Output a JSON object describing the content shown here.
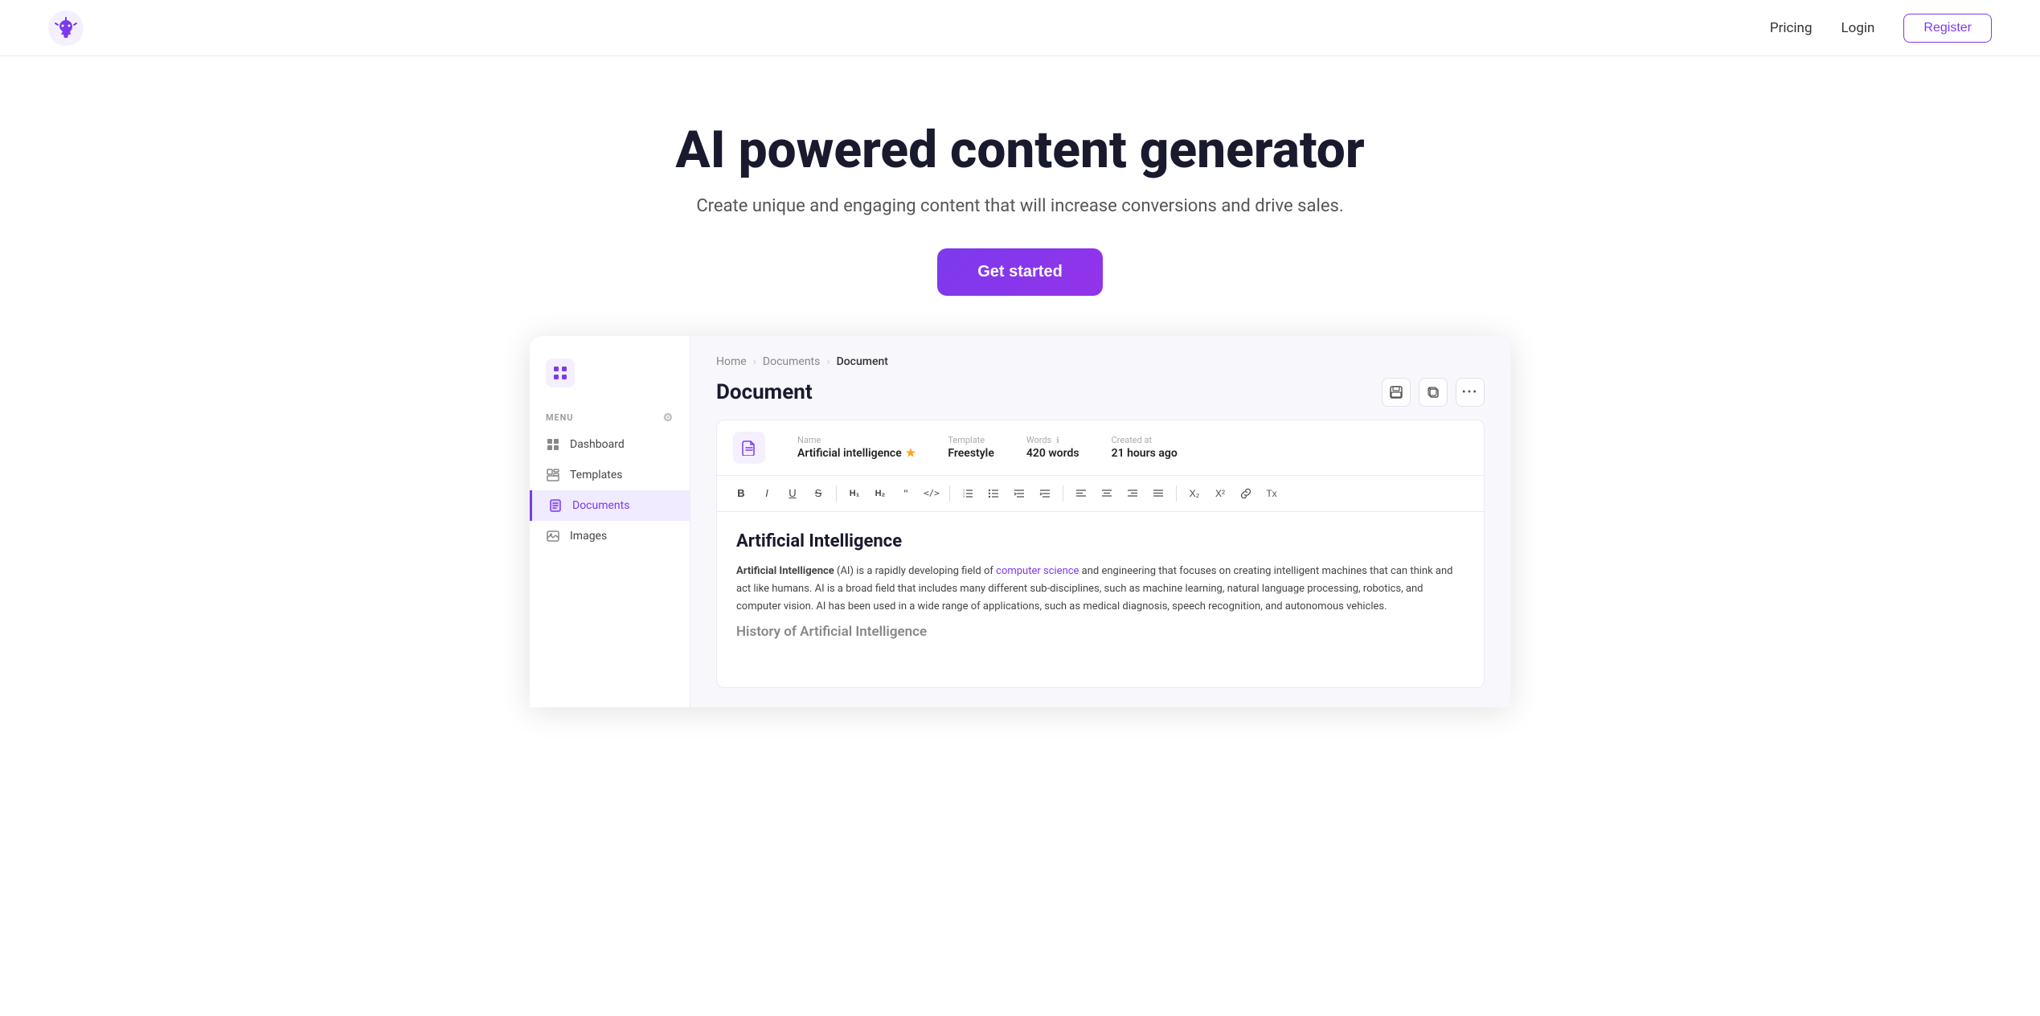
{
  "navbar": {
    "pricing_label": "Pricing",
    "login_label": "Login",
    "register_label": "Register"
  },
  "hero": {
    "headline": "AI powered content generator",
    "subheadline": "Create unique and engaging content that will increase conversions and drive sales.",
    "cta_label": "Get started"
  },
  "sidebar": {
    "section_label": "MENU",
    "items": [
      {
        "label": "Dashboard",
        "id": "dashboard"
      },
      {
        "label": "Templates",
        "id": "templates"
      },
      {
        "label": "Documents",
        "id": "documents",
        "active": true
      },
      {
        "label": "Images",
        "id": "images"
      }
    ]
  },
  "breadcrumb": {
    "home": "Home",
    "documents": "Documents",
    "current": "Document"
  },
  "document": {
    "title": "Document",
    "meta": {
      "name_label": "Name",
      "name_value": "Artificial intelligence",
      "template_label": "Template",
      "template_value": "Freestyle",
      "words_label": "Words",
      "words_value": "420 words",
      "created_label": "Created at",
      "created_value": "21 hours ago"
    },
    "content": {
      "heading": "Artificial Intelligence",
      "intro_bold": "Artificial Intelligence",
      "intro_text": " (AI) is a rapidly developing field of ",
      "intro_link": "computer science",
      "intro_rest": " and engineering that focuses on creating intelligent machines that can think and act like humans. AI is a broad field that includes many different sub-disciplines, such as machine learning, natural language processing, robotics, and computer vision. AI has been used in a wide range of applications, such as medical diagnosis, speech recognition, and autonomous vehicles.",
      "section2": "History of Artificial Intelligence"
    }
  }
}
